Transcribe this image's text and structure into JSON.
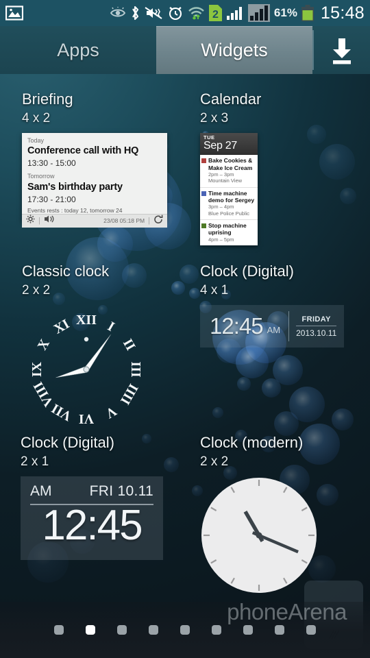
{
  "statusbar": {
    "time": "15:48",
    "battery_percent": "61%",
    "sim_badge": "2",
    "icons": [
      "gallery-icon",
      "smart-stay-icon",
      "bluetooth-icon",
      "mute-vibrate-icon",
      "alarm-icon",
      "wifi-icon",
      "sim2-icon",
      "signal-1-icon",
      "signal-2-icon",
      "battery-icon"
    ],
    "colors": {
      "bar_bg": "#1d5263",
      "battery_green": "#8cc63f",
      "sim_green": "#8cc63f"
    }
  },
  "tabs": {
    "apps_label": "Apps",
    "widgets_label": "Widgets",
    "active": "Widgets",
    "install_icon": "download-icon"
  },
  "widgets": [
    {
      "title": "Briefing",
      "size": "4 x 2",
      "preview": {
        "type": "briefing",
        "events": [
          {
            "day": "Today",
            "name": "Conference call with HQ",
            "time": "13:30 - 15:00"
          },
          {
            "day": "Tomorrow",
            "name": "Sam's birthday party",
            "time": "17:30 - 21:00"
          }
        ],
        "rest_text": "Events rests : today 12, tomorrow 24",
        "footer_date": "23/08 05:18 PM",
        "footer_icons": [
          "gear-icon",
          "briefing-speaker-icon",
          "refresh-icon"
        ]
      }
    },
    {
      "title": "Calendar",
      "size": "2 x 3",
      "preview": {
        "type": "calendar",
        "header_dow": "TUE",
        "header_date": "Sep 27",
        "events": [
          {
            "title": "Bake Cookies & Make Ice Cream",
            "time": "2pm – 3pm",
            "location": "Mountain View",
            "color": "#b0413e"
          },
          {
            "title": "Time machine demo for Sergey",
            "time": "3pm – 4pm",
            "location": "Blue Police Public",
            "color": "#4a63b5"
          },
          {
            "title": "Stop machine uprising",
            "time": "4pm – 5pm",
            "location": "",
            "color": "#4e7a26"
          }
        ]
      }
    },
    {
      "title": "Classic clock",
      "size": "2 x 2",
      "preview": {
        "type": "analog-roman",
        "numerals": [
          "XII",
          "I",
          "II",
          "III",
          "IIII",
          "V",
          "VI",
          "VII",
          "VIII",
          "IX",
          "X",
          "XI"
        ],
        "hour_angle": 255,
        "minute_angle": 35
      }
    },
    {
      "title": "Clock (Digital)",
      "size": "4 x 1",
      "preview": {
        "type": "digital-wide",
        "time": "12:45",
        "ampm": "AM",
        "dow": "FRIDAY",
        "date": "2013.10.11"
      }
    },
    {
      "title": "Clock (Digital)",
      "size": "2 x 1",
      "preview": {
        "type": "digital-compact",
        "ampm": "AM",
        "date": "FRI 10.11",
        "time": "12:45"
      }
    },
    {
      "title": "Clock (modern)",
      "size": "2 x 2",
      "preview": {
        "type": "analog-modern",
        "hour_angle": 330,
        "minute_angle": 113
      }
    }
  ],
  "pager": {
    "total": 9,
    "current": 2
  },
  "watermark": "phoneArena",
  "navbar": {
    "home_grip": "///"
  }
}
